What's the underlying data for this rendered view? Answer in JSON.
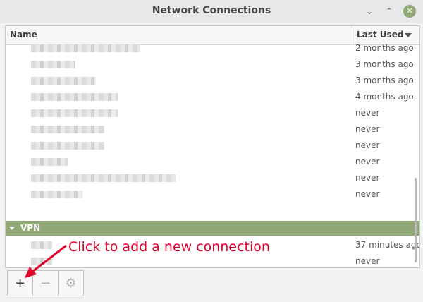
{
  "window": {
    "title": "Network Connections",
    "minimize": "⌄",
    "maximize": "⌃",
    "close": "✕"
  },
  "columns": {
    "name": "Name",
    "last_used": "Last Used"
  },
  "rows": [
    {
      "last_used": "2 months ago"
    },
    {
      "last_used": "3 months ago"
    },
    {
      "last_used": "3 months ago"
    },
    {
      "last_used": "4 months ago"
    },
    {
      "last_used": "never"
    },
    {
      "last_used": "never"
    },
    {
      "last_used": "never"
    },
    {
      "last_used": "never"
    },
    {
      "last_used": "never"
    },
    {
      "last_used": "never"
    }
  ],
  "vpn_group": {
    "label": "VPN",
    "rows": [
      {
        "last_used": "37 minutes ago"
      },
      {
        "last_used": "never"
      }
    ]
  },
  "toolbar": {
    "add": "+",
    "remove": "−",
    "settings": "⚙"
  },
  "annotation": {
    "text": "Click to add a new connection",
    "color": "#e0002a"
  },
  "colors": {
    "accent": "#8fa876"
  }
}
